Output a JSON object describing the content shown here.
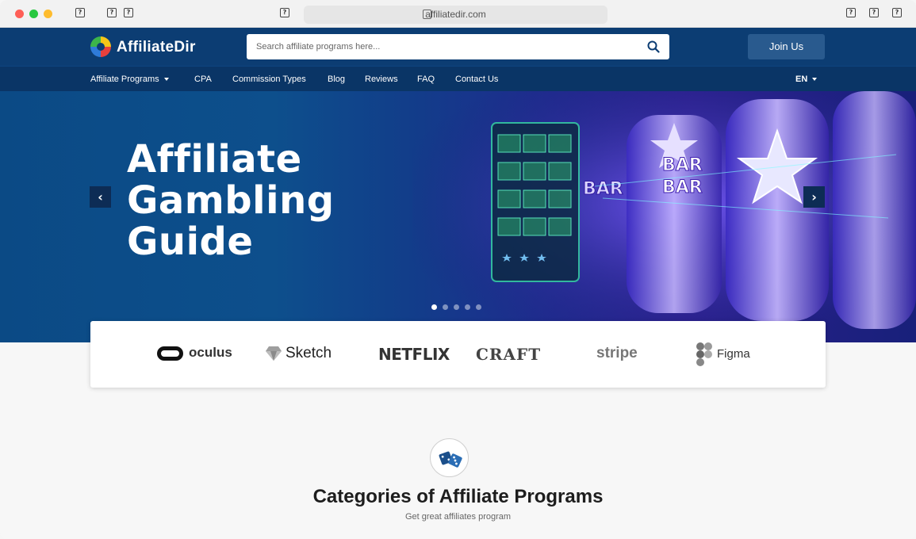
{
  "browser": {
    "url": "affiliatedir.com",
    "icons": [
      "window-icon",
      "back-icon",
      "forward-icon",
      "reader-icon",
      "share-icon",
      "new-tab-icon",
      "tabs-icon"
    ]
  },
  "header": {
    "logo_text": "AffiliateDir",
    "search_placeholder": "Search affiliate programs here...",
    "join_label": "Join Us"
  },
  "nav": {
    "items": [
      "Affiliate Programs",
      "CPA",
      "Commission Types",
      "Blog",
      "Reviews",
      "FAQ",
      "Contact Us"
    ],
    "language": "EN"
  },
  "hero": {
    "title_lines": [
      "Affiliate",
      "Gambling",
      "Guide"
    ],
    "slide_count": 5,
    "active_slide": 1
  },
  "brands": [
    "oculus",
    "Sketch",
    "NETFLIX",
    "CRAFT",
    "stripe",
    "Figma"
  ],
  "categories": {
    "title": "Categories of Affiliate Programs",
    "subtitle": "Get great affiliates program"
  },
  "colors": {
    "header_bg": "#0c3d73",
    "nav_bg": "#0a3566",
    "join_bg": "#295a8e"
  }
}
